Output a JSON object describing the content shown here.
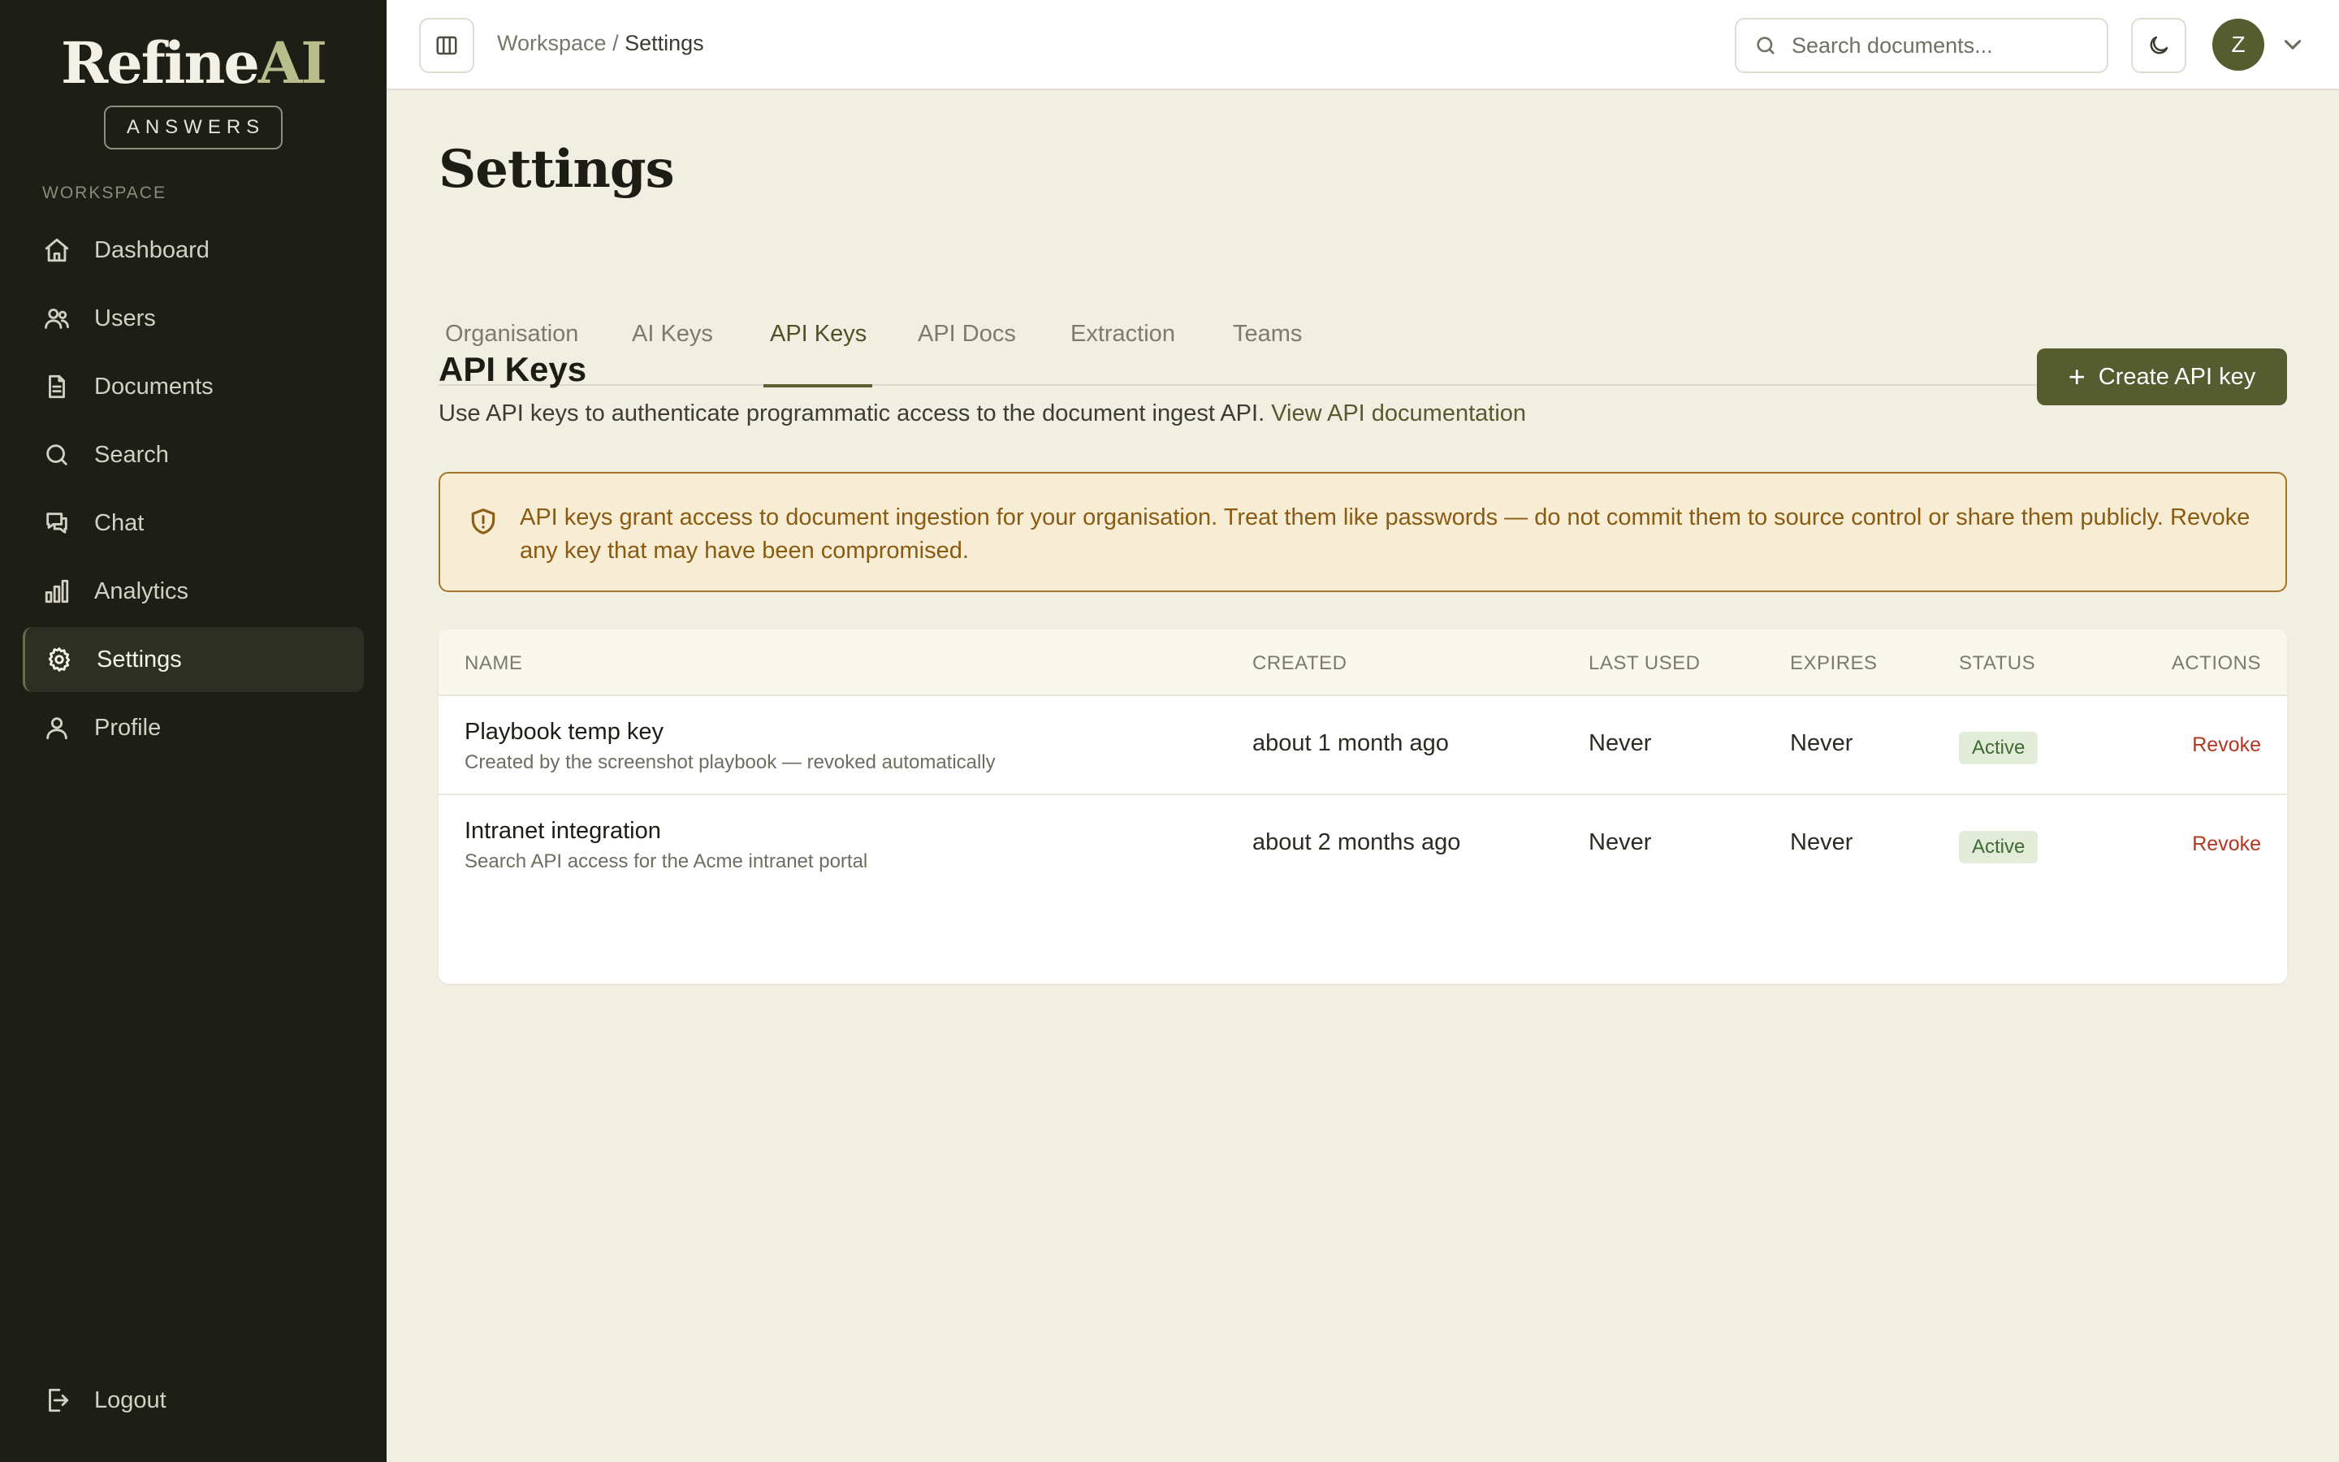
{
  "brand": {
    "name_main": "Refine",
    "name_accent": "AI",
    "badge": "ANSWERS"
  },
  "sidebar": {
    "section_label": "WORKSPACE",
    "items": [
      {
        "label": "Dashboard",
        "icon": "home-icon"
      },
      {
        "label": "Users",
        "icon": "users-icon"
      },
      {
        "label": "Documents",
        "icon": "document-icon"
      },
      {
        "label": "Search",
        "icon": "search-icon"
      },
      {
        "label": "Chat",
        "icon": "chat-icon"
      },
      {
        "label": "Analytics",
        "icon": "bar-chart-icon"
      },
      {
        "label": "Settings",
        "icon": "gear-icon",
        "active": true
      },
      {
        "label": "Profile",
        "icon": "user-icon"
      }
    ],
    "logout_label": "Logout"
  },
  "header": {
    "breadcrumb": {
      "parent": "Workspace",
      "separator": "/",
      "current": "Settings"
    },
    "search_placeholder": "Search documents...",
    "avatar_initial": "Z"
  },
  "page": {
    "title": "Settings",
    "tabs": [
      {
        "label": "Organisation"
      },
      {
        "label": "AI Keys"
      },
      {
        "label": "API Keys",
        "active": true
      },
      {
        "label": "API Docs"
      },
      {
        "label": "Extraction"
      },
      {
        "label": "Teams"
      }
    ],
    "section": {
      "title": "API Keys",
      "description": "Use API keys to authenticate programmatic access to the document ingest API.",
      "doc_link": "View API documentation",
      "create_button": "Create API key"
    },
    "warning": "API keys grant access to document ingestion for your organisation. Treat them like passwords — do not commit them to source control or share them publicly. Revoke any key that may have been compromised.",
    "table": {
      "columns": [
        "NAME",
        "CREATED",
        "LAST USED",
        "EXPIRES",
        "STATUS",
        "ACTIONS"
      ],
      "rows": [
        {
          "name": "Playbook temp key",
          "description": "Created by the screenshot playbook — revoked automatically",
          "created": "about 1 month ago",
          "last_used": "Never",
          "expires": "Never",
          "status": "Active",
          "action": "Revoke"
        },
        {
          "name": "Intranet integration",
          "description": "Search API access for the Acme intranet portal",
          "created": "about 2 months ago",
          "last_used": "Never",
          "expires": "Never",
          "status": "Active",
          "action": "Revoke"
        }
      ]
    }
  },
  "colors": {
    "sidebar_bg": "#1d1e16",
    "accent": "#545c30",
    "page_bg": "#f1eee2",
    "warning_text": "#8a5b12",
    "revoke": "#b3361f",
    "status_active_bg": "#e2ecd9"
  }
}
